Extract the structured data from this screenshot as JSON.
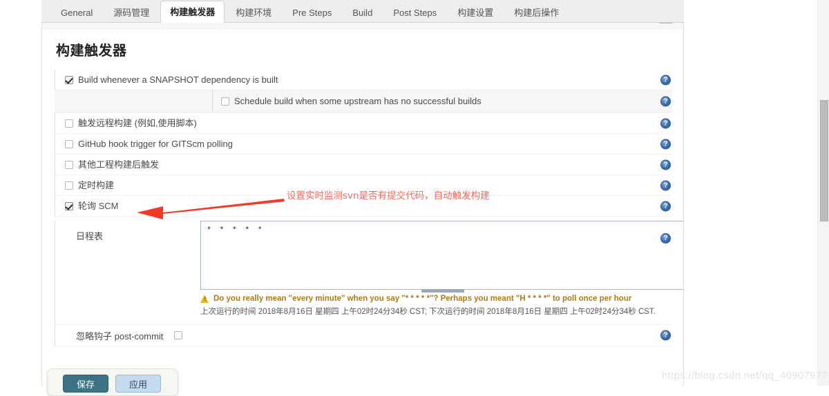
{
  "tabs": [
    {
      "label": "General",
      "active": false
    },
    {
      "label": "源码管理",
      "active": false
    },
    {
      "label": "构建触发器",
      "active": true
    },
    {
      "label": "构建环境",
      "active": false
    },
    {
      "label": "Pre Steps",
      "active": false
    },
    {
      "label": "Build",
      "active": false
    },
    {
      "label": "Post Steps",
      "active": false
    },
    {
      "label": "构建设置",
      "active": false
    },
    {
      "label": "构建后操作",
      "active": false
    }
  ],
  "section": {
    "title": "构建触发器"
  },
  "triggers": [
    {
      "label": "Build whenever a SNAPSHOT dependency is built",
      "checked": true
    },
    {
      "label": "触发远程构建 (例如,使用脚本)",
      "checked": false
    },
    {
      "label": "GitHub hook trigger for GITScm polling",
      "checked": false
    },
    {
      "label": "其他工程构建后触发",
      "checked": false
    },
    {
      "label": "定时构建",
      "checked": false
    },
    {
      "label": "轮询 SCM",
      "checked": true
    }
  ],
  "sub_option": {
    "label": "Schedule build when some upstream has no successful builds",
    "checked": false
  },
  "schedule": {
    "label": "日程表",
    "value": "* * * * *",
    "placeholder": "",
    "warning": "Do you really mean \"every minute\" when you say \"* * * * *\"? Perhaps you meant \"H * * * *\" to poll once per hour",
    "times": "上次运行的时间 2018年8月16日 星期四 上午02时24分34秒 CST; 下次运行的时间 2018年8月16日 星期四 上午02时24分34秒 CST."
  },
  "post_commit": {
    "label": "忽略钩子 post-commit",
    "checked": false
  },
  "buttons": {
    "save": "保存",
    "apply": "应用"
  },
  "annotation": {
    "text": "设置实时监测svn是否有提交代码，自动触发构建",
    "color": "#f4685e"
  },
  "watermark": "https://blog.csdn.net/qq_40907977",
  "icons": {
    "help": "help-question-icon",
    "warning": "warning-triangle-icon",
    "arrow": "red-arrow-annotation"
  },
  "colors": {
    "tab_bar_bg": "#ededed",
    "help_icon": "#3f6fae",
    "warning_text": "#b07a12",
    "save_button": "#3c7384",
    "apply_button": "#c5d9ef",
    "textarea_border": "#a9b6d6"
  }
}
